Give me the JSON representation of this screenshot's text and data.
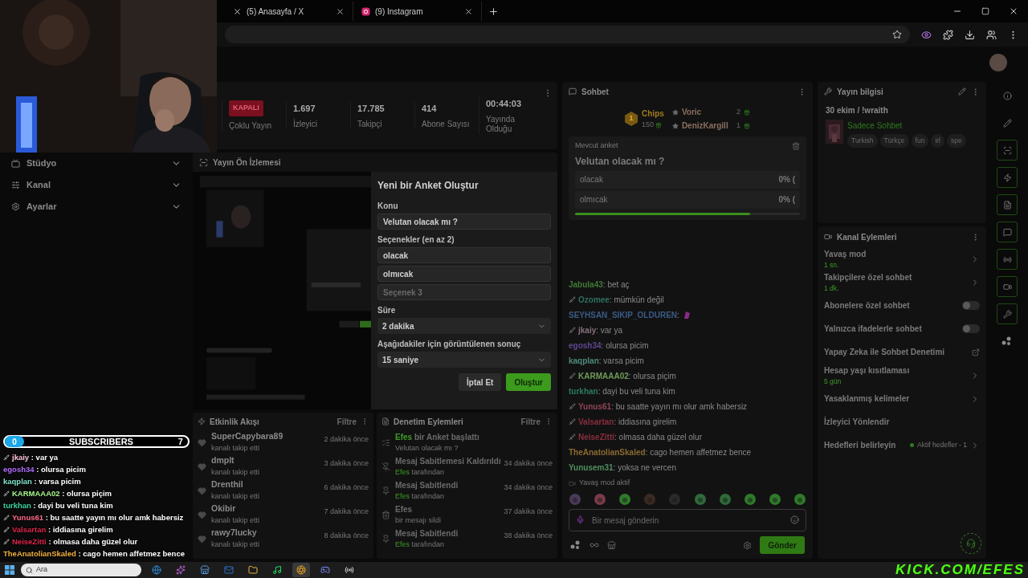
{
  "browser": {
    "tabs": [
      {
        "kind": "x",
        "title": "(5) Anasayfa / X"
      },
      {
        "kind": "instagram",
        "title": "(9) Instagram"
      }
    ]
  },
  "sidebar": {
    "items": [
      {
        "kind": "studio",
        "label": "Stüdyo"
      },
      {
        "kind": "channel",
        "label": "Kanal"
      },
      {
        "kind": "settings",
        "label": "Ayarlar"
      }
    ]
  },
  "stats": [
    {
      "kind": "badge",
      "value": "KAPALI",
      "label": "Çoklu Yayın"
    },
    {
      "kind": "number",
      "value": "1.697",
      "label": "İzleyici"
    },
    {
      "kind": "number",
      "value": "17.785",
      "label": "Takipçi"
    },
    {
      "kind": "number",
      "value": "414",
      "label": "Abone Sayısı"
    },
    {
      "kind": "number",
      "value": "00:44:03",
      "label": "Yayında Olduğu"
    }
  ],
  "preview": {
    "title": "Yayın Ön İzlemesi"
  },
  "poll_form": {
    "title": "Yeni bir Anket Oluştur",
    "topic_label": "Konu",
    "topic": "Velutan olacak mı ?",
    "options_label": "Seçenekler (en az 2)",
    "options": [
      {
        "value": "olacak"
      },
      {
        "value": "olmıcak"
      },
      {
        "placeholder": "Seçenek 3"
      }
    ],
    "duration_label": "Süre",
    "duration": "2 dakika",
    "result_label": "Aşağıdakiler için görüntülenen sonuç",
    "result": "15 saniye",
    "cancel": "İptal Et",
    "submit": "Oluştur"
  },
  "activity": {
    "title": "Etkinlik Akışı",
    "filter": "Filtre",
    "rows": [
      {
        "name": "SuperCapybara89",
        "text": "kanalı takip etti",
        "time": "2 dakika önce"
      },
      {
        "name": "dmplt",
        "text": "kanalı takip etti",
        "time": "3 dakika önce"
      },
      {
        "name": "Drenthil",
        "text": "kanalı takip etti",
        "time": "6 dakika önce"
      },
      {
        "name": "Okibir",
        "text": "kanalı takip etti",
        "time": "7 dakika önce"
      },
      {
        "name": "rawy7lucky",
        "text": "kanalı takip etti",
        "time": "8 dakika önce"
      }
    ]
  },
  "moderation": {
    "title": "Denetim Eylemleri",
    "filter": "Filtre",
    "rows": [
      {
        "kind": "poll",
        "actor": "Efes",
        "title": "bir Anket başlattı",
        "subtitle": "Velutan olacak mı ?"
      },
      {
        "kind": "unpin",
        "title": "Mesaj Sabitlemesi Kaldırıldı",
        "sub_actor": "Efes",
        "subtitle": "tarafından",
        "time": "34 dakika önce"
      },
      {
        "kind": "pin",
        "title": "Mesaj Sabitlendi",
        "sub_actor": "Efes",
        "subtitle": "tarafından",
        "time": "34 dakika önce"
      },
      {
        "kind": "delete",
        "title": "Efes",
        "subtitle": "bir mesajı sildi",
        "time": "37 dakika önce"
      },
      {
        "kind": "pin",
        "title": "Mesaj Sabitlendi",
        "sub_actor": "Efes",
        "subtitle": "tarafından",
        "time": "38 dakika önce"
      }
    ]
  },
  "chat": {
    "title": "Sohbet",
    "leaders": [
      {
        "kind": "top",
        "rank": "1",
        "name": "Chips",
        "count": "150"
      },
      {
        "kind": "other",
        "name": "Voric",
        "count": "2"
      },
      {
        "kind": "other",
        "name": "DenizKargill",
        "count": "1"
      }
    ],
    "poll": {
      "label": "Mevcut anket",
      "question": "Velutan olacak mı ?",
      "options": [
        {
          "text": "olacak",
          "result": "0% ("
        },
        {
          "text": "olmıcak",
          "result": "0% ("
        }
      ],
      "level": 0.78
    },
    "messages": [
      {
        "kind": "text",
        "user": "Jabula43",
        "color": "#3f7a34",
        "badge": false,
        "text": "bet aç"
      },
      {
        "kind": "text",
        "user": "Ozomee",
        "color": "#2f6f5f",
        "badge": true,
        "text": "mümkün değil"
      },
      {
        "kind": "emote",
        "user": "SEYHSAN_SIKIP_OLDUREN",
        "color": "#3b5b86",
        "badge": false
      },
      {
        "kind": "text",
        "user": "jkaiy",
        "color": "#8a6f80",
        "badge": true,
        "text": "var ya"
      },
      {
        "kind": "text",
        "user": "egosh34",
        "color": "#5e4790",
        "badge": false,
        "text": "olursa picim"
      },
      {
        "kind": "text",
        "user": "kaqplan",
        "color": "#4f8a7c",
        "badge": false,
        "text": "varsa picim"
      },
      {
        "kind": "text",
        "user": "KARMAAA02",
        "color": "#6f9a5a",
        "badge": true,
        "text": "olursa piçim"
      },
      {
        "kind": "text",
        "user": "turkhan",
        "color": "#2a7a60",
        "badge": false,
        "text": "dayi bu veli tuna kim"
      },
      {
        "kind": "text",
        "user": "Yunus61",
        "color": "#8f4558",
        "badge": true,
        "text": "bu saatte yayın mı olur amk habersiz"
      },
      {
        "kind": "text",
        "user": "Valsartan",
        "color": "#8a2e3e",
        "badge": true,
        "text": "iddiasına girelim"
      },
      {
        "kind": "text",
        "user": "NeiseZitti",
        "color": "#8a2e3e",
        "badge": true,
        "text": "olmasa daha güzel olur"
      },
      {
        "kind": "text",
        "user": "TheAnatolianSkaled",
        "color": "#8c6a32",
        "badge": false,
        "text": "cago hemen affetmez bence"
      },
      {
        "kind": "text",
        "user": "Yunusem31",
        "color": "#4f8f5f",
        "badge": false,
        "text": "yoksa ne vercen"
      }
    ],
    "separator": ":",
    "slow_mode": "Yavaş mod aktif",
    "input_placeholder": "Bir mesaj gönderin",
    "send": "Gönder"
  },
  "channel_info": {
    "title": "Yayın bilgisi",
    "stream_title": "30 ekim / !wraith",
    "category": "Sadece Sohbet",
    "tags": [
      "Turkish",
      "Türkçe",
      "fun",
      "irl",
      "spe"
    ]
  },
  "channel_actions": {
    "title": "Kanal Eylemleri",
    "items": [
      {
        "kind": "link",
        "label": "Yavaş mod",
        "value": "1 sn."
      },
      {
        "kind": "link",
        "label": "Takipçilere özel sohbet",
        "value": "1 dk."
      },
      {
        "kind": "toggle",
        "label": "Abonelere özel sohbet",
        "on": false
      },
      {
        "kind": "toggle",
        "label": "Yalnızca ifadelerle sohbet",
        "on": false
      },
      {
        "kind": "external",
        "label": "Yapay Zeka ile Sohbet Denetimi"
      },
      {
        "kind": "link",
        "label": "Hesap yaşı kısıtlaması",
        "value": "5 gün"
      },
      {
        "kind": "link",
        "label": "Yasaklanmış kelimeler"
      },
      {
        "kind": "plain",
        "label": "İzleyici Yönlendir"
      },
      {
        "kind": "status",
        "label": "Hedefleri belirleyin",
        "value": "Aktif hedefler - 1"
      }
    ]
  },
  "rail": [
    {
      "kind": "info",
      "outlined": false
    },
    {
      "kind": "edit",
      "outlined": false
    },
    {
      "kind": "screen",
      "outlined": true
    },
    {
      "kind": "events",
      "outlined": true
    },
    {
      "kind": "log",
      "outlined": true
    },
    {
      "kind": "chat",
      "outlined": true
    },
    {
      "kind": "broadcast",
      "outlined": true
    },
    {
      "kind": "channel",
      "outlined": true
    },
    {
      "kind": "tools",
      "outlined": true
    },
    {
      "kind": "dots",
      "outlined": false
    }
  ],
  "overlay": {
    "label": "SUBSCRIBERS",
    "current": "0",
    "goal": "7",
    "separator": ":",
    "messages": [
      {
        "user": "jkaiy",
        "color": "#ffc2dc",
        "badge": true,
        "text": "var ya"
      },
      {
        "user": "egosh34",
        "color": "#b06bff",
        "badge": false,
        "text": "olursa picim"
      },
      {
        "user": "kaqplan",
        "color": "#7fe0c8",
        "badge": false,
        "text": "varsa picim"
      },
      {
        "user": "KARMAAA02",
        "color": "#a6f58a",
        "badge": true,
        "text": "olursa piçim"
      },
      {
        "user": "turkhan",
        "color": "#38d39f",
        "badge": false,
        "text": "dayi bu veli tuna kim"
      },
      {
        "user": "Yunus61",
        "color": "#ff6b8b",
        "badge": true,
        "text": "bu saatte yayın mı olur amk habersiz"
      },
      {
        "user": "Valsartan",
        "color": "#e0244a",
        "badge": true,
        "text": "iddiasına girelim"
      },
      {
        "user": "NeiseZitti",
        "color": "#e0244a",
        "badge": true,
        "text": "olmasa daha güzel olur"
      },
      {
        "user": "TheAnatolianSkaled",
        "color": "#f0b040",
        "badge": false,
        "text": "cago hemen affetmez bence"
      }
    ]
  },
  "taskbar": {
    "search": "Ara",
    "apps": [
      {
        "kind": "edge",
        "selected": false
      },
      {
        "kind": "copilot",
        "selected": false
      },
      {
        "kind": "store",
        "selected": false
      },
      {
        "kind": "outlook",
        "selected": false
      },
      {
        "kind": "explorer",
        "selected": false
      },
      {
        "kind": "spotify",
        "selected": false
      },
      {
        "kind": "chrome",
        "selected": true
      },
      {
        "kind": "discord",
        "selected": false
      },
      {
        "kind": "obs",
        "selected": false
      }
    ]
  },
  "branding": "KICK.COM/EFES"
}
